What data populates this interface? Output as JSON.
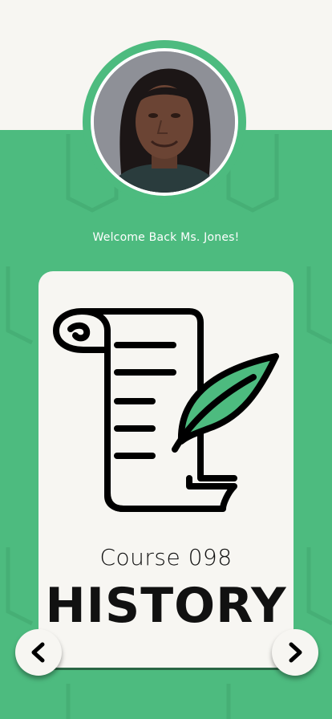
{
  "profile": {
    "avatar_icon": "teacher-portrait",
    "welcome_text": "Welcome Back Ms. Jones!"
  },
  "course": {
    "number_label": "Course 098",
    "title": "HISTORY",
    "illustration_icon": "scroll-quill-icon"
  },
  "navigation": {
    "prev_icon": "chevron-left-icon",
    "next_icon": "chevron-right-icon"
  },
  "colors": {
    "accent_green": "#4dbb7f",
    "background": "#f7f6f2",
    "ink": "#111111"
  }
}
